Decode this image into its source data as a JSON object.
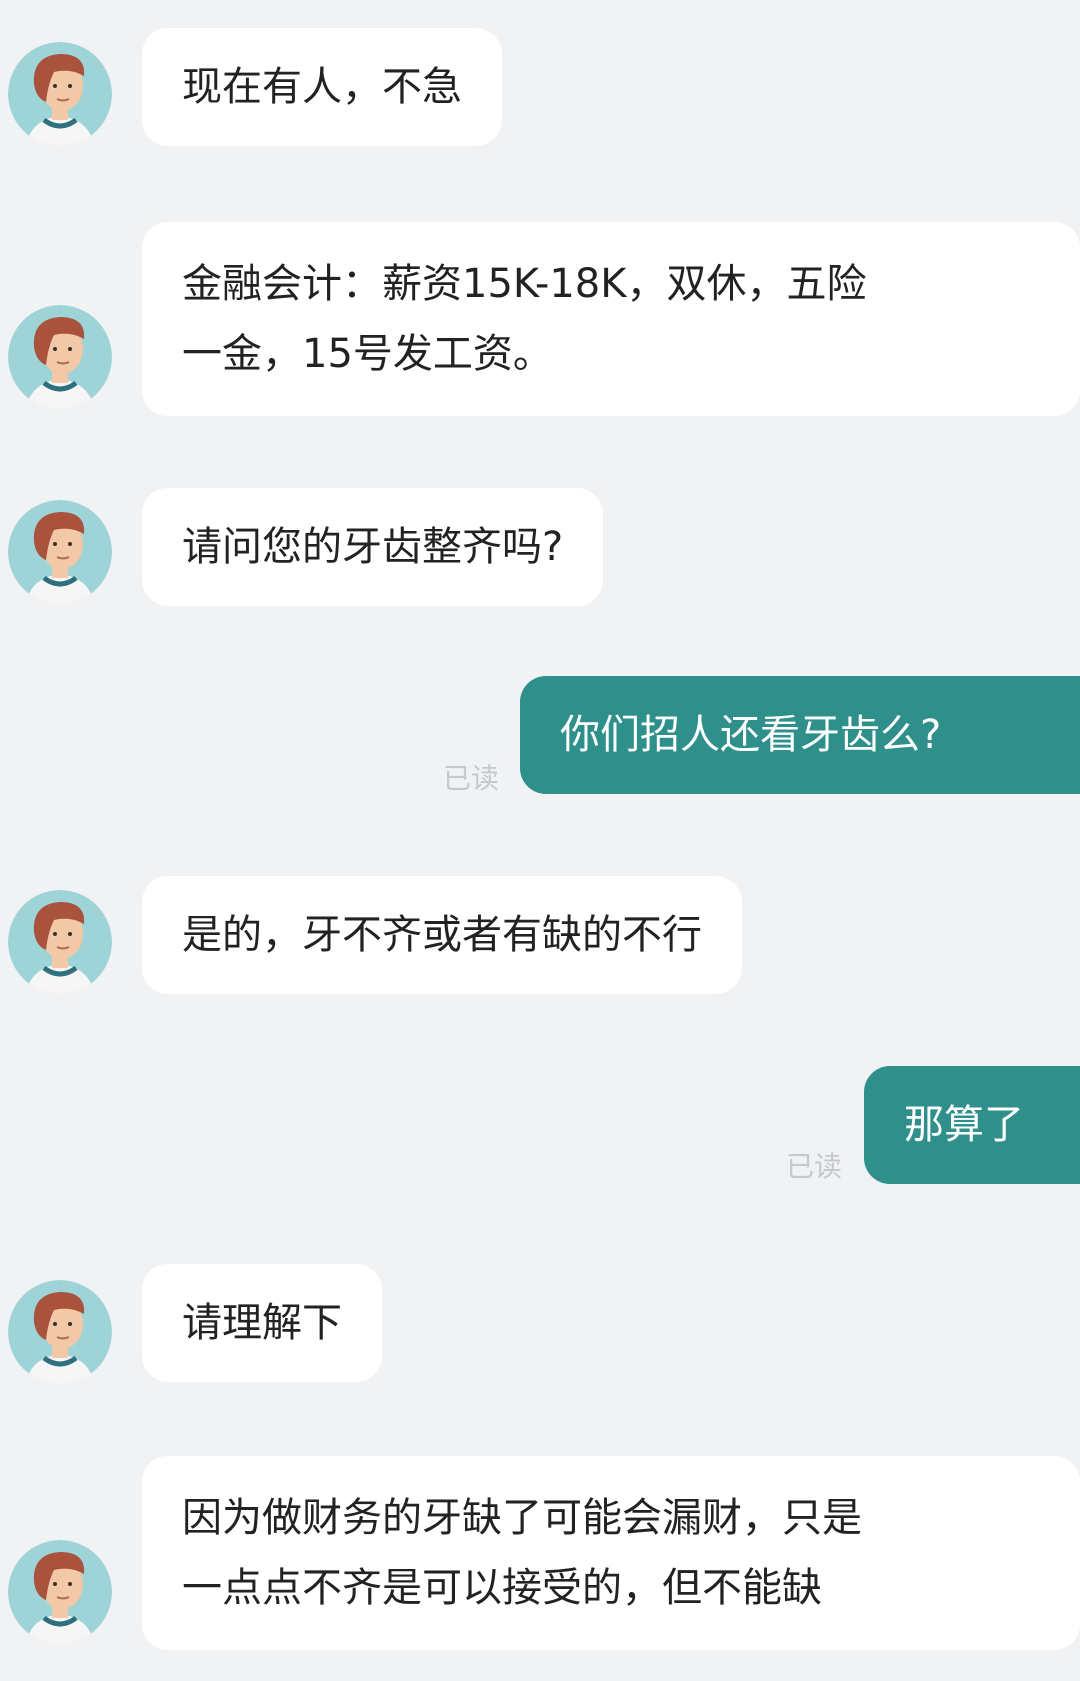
{
  "colors": {
    "background": "#f1f2f4",
    "incoming_bubble": "#ffffff",
    "outgoing_bubble": "#2e8f8b",
    "read_status": "#c5c8cc",
    "avatar_bg": "#9ed3d7"
  },
  "icons": {
    "contact_avatar": "recruiter-avatar-icon"
  },
  "messages": [
    {
      "sender": "recruiter",
      "text": "现在有人，不急"
    },
    {
      "sender": "recruiter",
      "lines": [
        "金融会计：薪资15K-18K，双休，五险",
        "一金，15号发工资。"
      ]
    },
    {
      "sender": "recruiter",
      "text": "请问您的牙齿整齐吗?"
    },
    {
      "sender": "me",
      "text": "你们招人还看牙齿么?",
      "status": "已读"
    },
    {
      "sender": "recruiter",
      "text": "是的，牙不齐或者有缺的不行"
    },
    {
      "sender": "me",
      "text": "那算了",
      "status": "已读"
    },
    {
      "sender": "recruiter",
      "text": "请理解下"
    },
    {
      "sender": "recruiter",
      "lines": [
        "因为做财务的牙缺了可能会漏财，只是",
        "一点点不齐是可以接受的，但不能缺"
      ]
    }
  ]
}
